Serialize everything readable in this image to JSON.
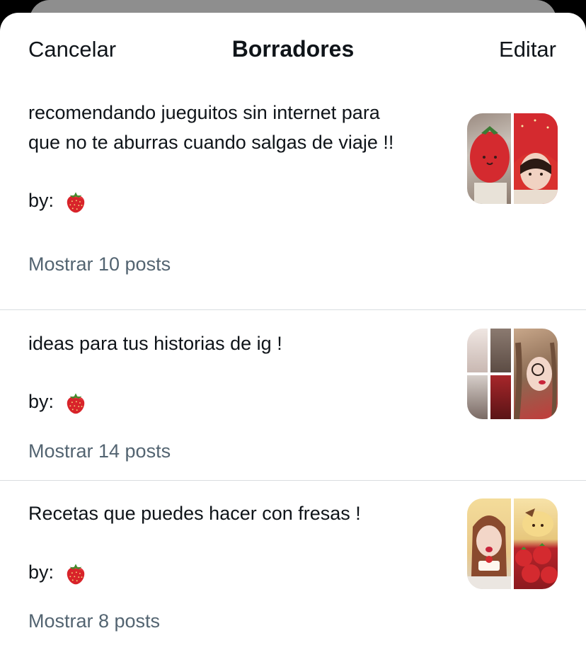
{
  "header": {
    "cancel_label": "Cancelar",
    "title": "Borradores",
    "edit_label": "Editar"
  },
  "drafts": [
    {
      "text_line1": "recomendando jueguitos sin internet para",
      "text_line2": "que no te aburras cuando salgas de viaje !!",
      "byline": "by:",
      "byline_emoji": "strawberry-icon",
      "more_label": "Mostrar 10 posts",
      "thumbnail": "strawberry-plush-and-girl-in-strawberry-hat"
    },
    {
      "text_line1": "ideas para tus historias de ig !",
      "byline": "by:",
      "byline_emoji": "strawberry-icon",
      "more_label": "Mostrar 14 posts",
      "thumbnail": "story-collage-and-girl-with-braids"
    },
    {
      "text_line1": "Recetas que puedes hacer con fresas !",
      "byline": "by:",
      "byline_emoji": "strawberry-icon",
      "more_label": "Mostrar 8 posts",
      "thumbnail": "girl-with-cake-and-strawberries"
    }
  ],
  "colors": {
    "text": "#0f1419",
    "secondary": "#536471",
    "divider": "#d9dde0",
    "backdrop": "#000000"
  }
}
